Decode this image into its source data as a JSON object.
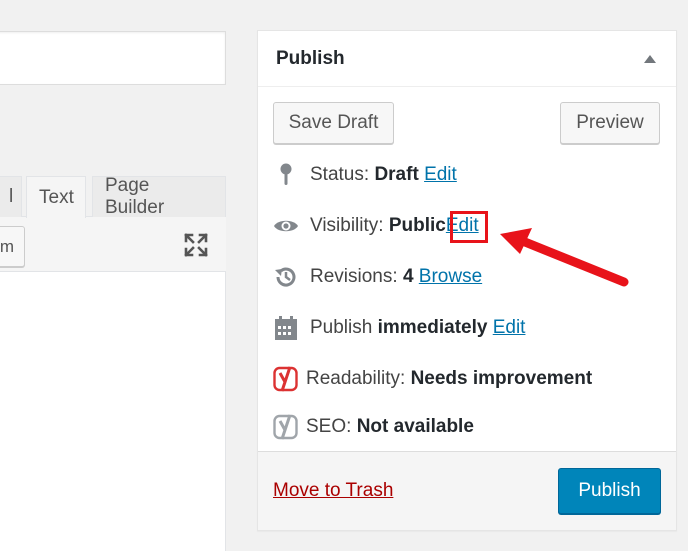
{
  "editor": {
    "tabs": [
      {
        "label": "l"
      },
      {
        "label": "Text"
      },
      {
        "label": "Page Builder"
      }
    ],
    "media_button_label": "m"
  },
  "publish": {
    "title": "Publish",
    "save_draft_label": "Save Draft",
    "preview_label": "Preview",
    "status": {
      "label": "Status:",
      "value": "Draft",
      "edit": "Edit"
    },
    "visibility": {
      "label": "Visibility:",
      "value": "Public",
      "edit": "Edit"
    },
    "revisions": {
      "label": "Revisions:",
      "value": "4",
      "browse": "Browse"
    },
    "schedule": {
      "label": "Publish",
      "value": "immediately",
      "edit": "Edit"
    },
    "readability": {
      "label": "Readability:",
      "value": "Needs improvement"
    },
    "seo": {
      "label": "SEO:",
      "value": "Not available"
    },
    "trash_label": "Move to Trash",
    "publish_label": "Publish"
  },
  "colors": {
    "link": "#0073aa",
    "primary": "#0085ba",
    "trash": "#a00",
    "annotation": "#e8131a",
    "yoast_red": "#dc3232"
  }
}
